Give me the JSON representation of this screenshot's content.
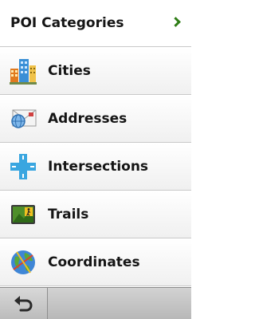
{
  "header": {
    "title": "POI Categories",
    "chevron_icon": "chevron-right-icon",
    "accent_color": "#2f7d16"
  },
  "menu": {
    "items": [
      {
        "label": "Cities",
        "icon": "city-buildings-icon"
      },
      {
        "label": "Addresses",
        "icon": "address-envelope-icon"
      },
      {
        "label": "Intersections",
        "icon": "intersection-cross-icon"
      },
      {
        "label": "Trails",
        "icon": "hiker-sign-icon"
      },
      {
        "label": "Coordinates",
        "icon": "globe-coordinates-icon"
      }
    ]
  },
  "footer": {
    "back_icon": "back-arrow-icon"
  }
}
